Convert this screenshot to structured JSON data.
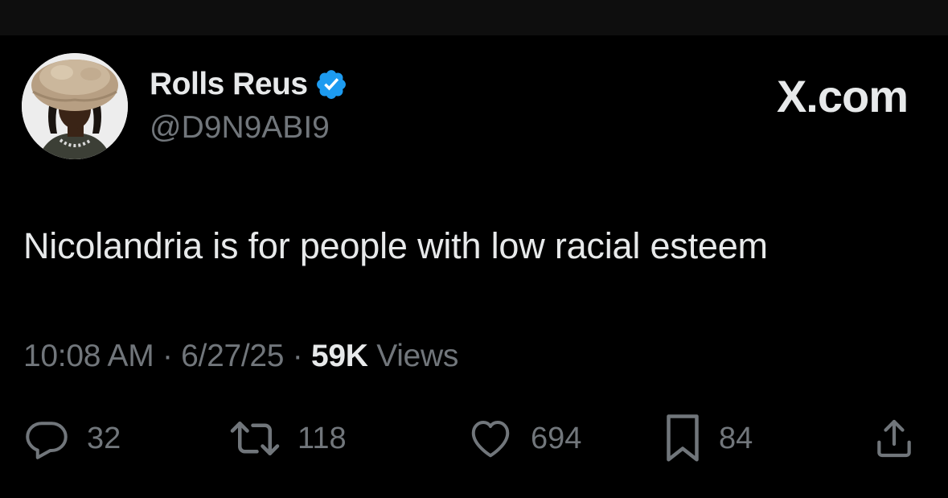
{
  "brand": {
    "site_label": "X.com",
    "verified_color": "#1d9bf0",
    "text_color": "#e7e9ea",
    "muted_color": "#71767b"
  },
  "author": {
    "display_name": "Rolls Reus",
    "handle": "@D9N9ABI9",
    "verified": true,
    "avatar_icon": "profile-photo"
  },
  "tweet": {
    "text": "Nicolandria is for people with low racial esteem",
    "time": "10:08 AM",
    "date": "6/27/25",
    "separator": "·",
    "views_count": "59K",
    "views_label": "Views"
  },
  "actions": {
    "reply": {
      "icon": "reply-icon",
      "count": "32"
    },
    "repost": {
      "icon": "repost-icon",
      "count": "118"
    },
    "like": {
      "icon": "heart-icon",
      "count": "694"
    },
    "bookmark": {
      "icon": "bookmark-icon",
      "count": "84"
    },
    "share": {
      "icon": "share-icon"
    }
  }
}
